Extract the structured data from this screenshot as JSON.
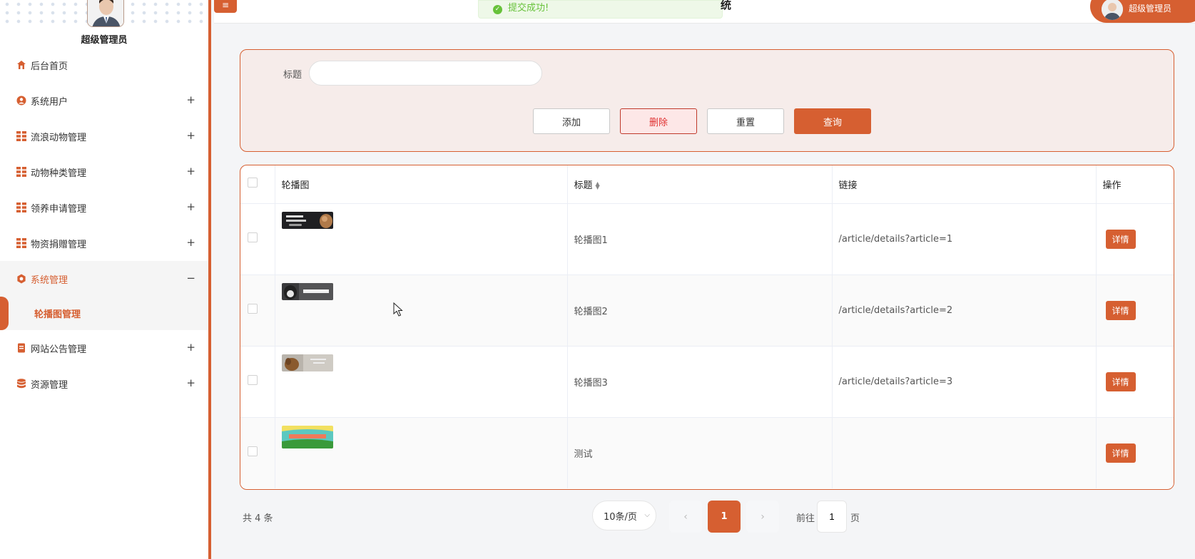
{
  "sidebar": {
    "admin_name": "超级管理员",
    "items": [
      {
        "label": "后台首页",
        "icon": "home-icon",
        "toggle": ""
      },
      {
        "label": "系统用户",
        "icon": "user-circle-icon",
        "toggle": "+"
      },
      {
        "label": "流浪动物管理",
        "icon": "grid-icon",
        "toggle": "+"
      },
      {
        "label": "动物种类管理",
        "icon": "grid-icon",
        "toggle": "+"
      },
      {
        "label": "领养申请管理",
        "icon": "grid-icon",
        "toggle": "+"
      },
      {
        "label": "物资捐赠管理",
        "icon": "grid-icon",
        "toggle": "+"
      },
      {
        "label": "系统管理",
        "icon": "gear-icon",
        "toggle": "−"
      },
      {
        "label": "网站公告管理",
        "icon": "notice-icon",
        "toggle": "+"
      },
      {
        "label": "资源管理",
        "icon": "database-icon",
        "toggle": "+"
      }
    ],
    "subitem": "轮播图管理"
  },
  "header": {
    "menu_icon": "≡",
    "toast": "提交成功!",
    "title_fragment": "统",
    "user": "超级管理员"
  },
  "search": {
    "label": "标题",
    "value": "",
    "placeholder": "",
    "buttons": {
      "add": "添加",
      "delete": "删除",
      "reset": "重置",
      "query": "查询"
    }
  },
  "table": {
    "headers": {
      "image": "轮播图",
      "title": "标题",
      "link": "链接",
      "action": "操作"
    },
    "rows": [
      {
        "title": "轮播图1",
        "link": "/article/details?article=1",
        "action": "详情"
      },
      {
        "title": "轮播图2",
        "link": "/article/details?article=2",
        "action": "详情"
      },
      {
        "title": "轮播图3",
        "link": "/article/details?article=3",
        "action": "详情"
      },
      {
        "title": "测试",
        "link": "",
        "action": "详情"
      }
    ]
  },
  "pagination": {
    "total": "共 4 条",
    "page_size": "10条/页",
    "current_page": "1",
    "goto_label": "前往",
    "goto_value": "1",
    "goto_suffix": "页"
  },
  "colors": {
    "accent": "#d65f31",
    "panel_bg": "#f6ecea",
    "success": "#67c23a"
  }
}
